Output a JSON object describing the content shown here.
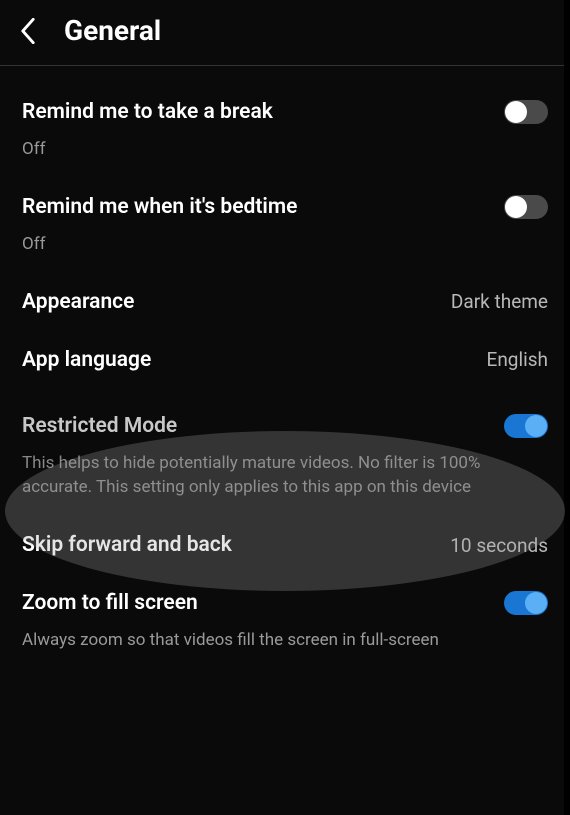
{
  "header": {
    "title": "General"
  },
  "settings": {
    "break": {
      "label": "Remind me to take a break",
      "status": "Off",
      "toggle": false
    },
    "bedtime": {
      "label": "Remind me when it's bedtime",
      "status": "Off",
      "toggle": false
    },
    "appearance": {
      "label": "Appearance",
      "value": "Dark theme"
    },
    "language": {
      "label": "App language",
      "value": "English"
    },
    "restricted": {
      "label": "Restricted Mode",
      "description": "This helps to hide potentially mature videos. No filter is 100% accurate. This setting only applies to this app on this device",
      "toggle": true
    },
    "skip": {
      "label": "Skip forward and back",
      "value": "10 seconds"
    },
    "zoom": {
      "label": "Zoom to fill screen",
      "description": "Always zoom so that videos fill the screen in full-screen",
      "toggle": true
    }
  }
}
